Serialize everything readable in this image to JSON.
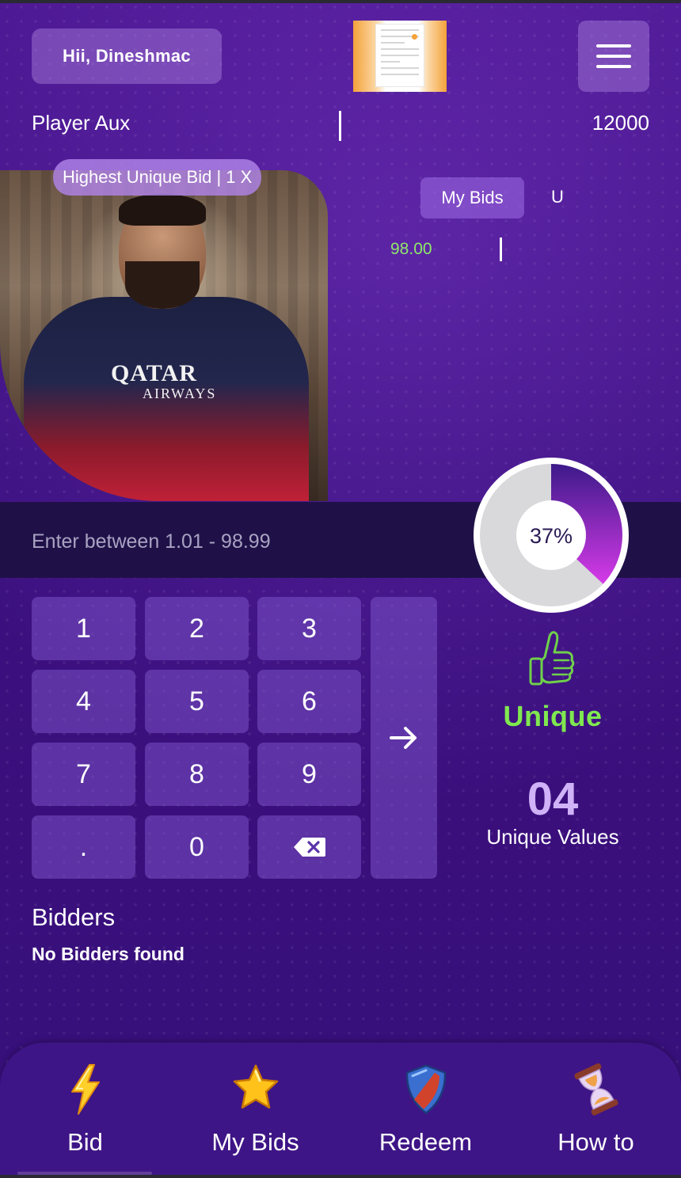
{
  "header": {
    "greeting": "Hii, Dineshmac",
    "player_name": "Player Aux",
    "balance": "12000"
  },
  "auction": {
    "badge": "Highest Unique Bid | 1 X",
    "tab_my_bids": "My Bids",
    "tab_unique": "U",
    "my_bid_value": "98.00"
  },
  "bid_input": {
    "placeholder": "Enter between 1.01 - 98.99"
  },
  "progress": {
    "label": "37%",
    "fraction": 0.37
  },
  "keypad": {
    "keys": [
      "1",
      "2",
      "3",
      "4",
      "5",
      "6",
      "7",
      "8",
      "9",
      ".",
      "0"
    ]
  },
  "unique_stats": {
    "status": "Unique",
    "count": "04",
    "count_label": "Unique Values"
  },
  "bidders": {
    "title": "Bidders",
    "empty_message": "No Bidders found"
  },
  "bottom_nav": {
    "items": [
      {
        "label": "Bid",
        "icon": "lightning-icon"
      },
      {
        "label": "My Bids",
        "icon": "star-icon"
      },
      {
        "label": "Redeem",
        "icon": "shield-icon"
      },
      {
        "label": "How to",
        "icon": "hourglass-icon"
      }
    ]
  },
  "colors": {
    "background": "#3a0f7a",
    "input_bar": "#1f1148",
    "unique_green": "#7fe84f",
    "bid_green": "#8fe86a",
    "count_lavender": "#cfb2f7",
    "progress_magenta": "#d63ae8"
  }
}
